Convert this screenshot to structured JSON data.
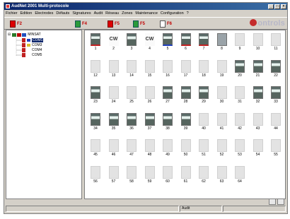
{
  "window": {
    "title": "AudNet 2001 Multi-protocole",
    "controls": [
      "_",
      "□",
      "×"
    ]
  },
  "menu": [
    "Fichier",
    "Edition",
    "Electrodes",
    "Défauts",
    "Signatures",
    "Audit",
    "Réseau",
    "Zones",
    "Maintenance",
    "Configuration",
    "?"
  ],
  "toolbar": {
    "buttons": [
      {
        "label": "F2"
      },
      {
        "label": "F4"
      },
      {
        "label": "F5"
      },
      {
        "label": "F5"
      },
      {
        "label": "F6"
      }
    ],
    "logo_text": "ontrols"
  },
  "tree": {
    "root": "MINSAT",
    "ports": [
      "COM1",
      "COM3",
      "COM4",
      "COM5"
    ],
    "selected": "COM1"
  },
  "devices": [
    {
      "n": "1",
      "s": "active a1"
    },
    {
      "n": "2",
      "s": "cw"
    },
    {
      "n": "3",
      "s": "active"
    },
    {
      "n": "4",
      "s": "cw"
    },
    {
      "n": "5",
      "s": "active a2"
    },
    {
      "n": "6",
      "s": "active a1"
    },
    {
      "n": "7",
      "s": "active a1"
    },
    {
      "n": "8",
      "s": "blank"
    },
    {
      "n": "9",
      "s": "empty"
    },
    {
      "n": "10",
      "s": "empty"
    },
    {
      "n": "11",
      "s": "empty"
    },
    {
      "n": "12",
      "s": "empty"
    },
    {
      "n": "13",
      "s": "empty"
    },
    {
      "n": "14",
      "s": "empty"
    },
    {
      "n": "15",
      "s": "empty"
    },
    {
      "n": "16",
      "s": "empty"
    },
    {
      "n": "17",
      "s": "empty"
    },
    {
      "n": "18",
      "s": "empty"
    },
    {
      "n": "19",
      "s": "empty"
    },
    {
      "n": "20",
      "s": "active"
    },
    {
      "n": "21",
      "s": "active"
    },
    {
      "n": "22",
      "s": "active"
    },
    {
      "n": "23",
      "s": "active"
    },
    {
      "n": "24",
      "s": "empty"
    },
    {
      "n": "25",
      "s": "empty"
    },
    {
      "n": "26",
      "s": "empty"
    },
    {
      "n": "27",
      "s": "active"
    },
    {
      "n": "28",
      "s": "active"
    },
    {
      "n": "29",
      "s": "active"
    },
    {
      "n": "30",
      "s": "empty"
    },
    {
      "n": "31",
      "s": "empty"
    },
    {
      "n": "32",
      "s": "active"
    },
    {
      "n": "33",
      "s": "active"
    },
    {
      "n": "34",
      "s": "active"
    },
    {
      "n": "35",
      "s": "active"
    },
    {
      "n": "36",
      "s": "active"
    },
    {
      "n": "37",
      "s": "active"
    },
    {
      "n": "38",
      "s": "active"
    },
    {
      "n": "39",
      "s": "active"
    },
    {
      "n": "40",
      "s": "empty"
    },
    {
      "n": "41",
      "s": "empty"
    },
    {
      "n": "42",
      "s": "empty"
    },
    {
      "n": "43",
      "s": "empty"
    },
    {
      "n": "44",
      "s": "empty"
    },
    {
      "n": "45",
      "s": "empty"
    },
    {
      "n": "46",
      "s": "empty"
    },
    {
      "n": "47",
      "s": "empty"
    },
    {
      "n": "48",
      "s": "empty"
    },
    {
      "n": "49",
      "s": "empty"
    },
    {
      "n": "50",
      "s": "empty"
    },
    {
      "n": "51",
      "s": "empty"
    },
    {
      "n": "52",
      "s": "empty"
    },
    {
      "n": "53",
      "s": "empty"
    },
    {
      "n": "54",
      "s": "empty"
    },
    {
      "n": "55",
      "s": "empty"
    },
    {
      "n": "56",
      "s": "empty"
    },
    {
      "n": "57",
      "s": "empty"
    },
    {
      "n": "58",
      "s": "empty"
    },
    {
      "n": "59",
      "s": "empty"
    },
    {
      "n": "60",
      "s": "empty"
    },
    {
      "n": "61",
      "s": "empty"
    },
    {
      "n": "62",
      "s": "empty"
    },
    {
      "n": "63",
      "s": "empty"
    },
    {
      "n": "64",
      "s": "empty"
    }
  ],
  "status": {
    "mode": "Audit"
  }
}
